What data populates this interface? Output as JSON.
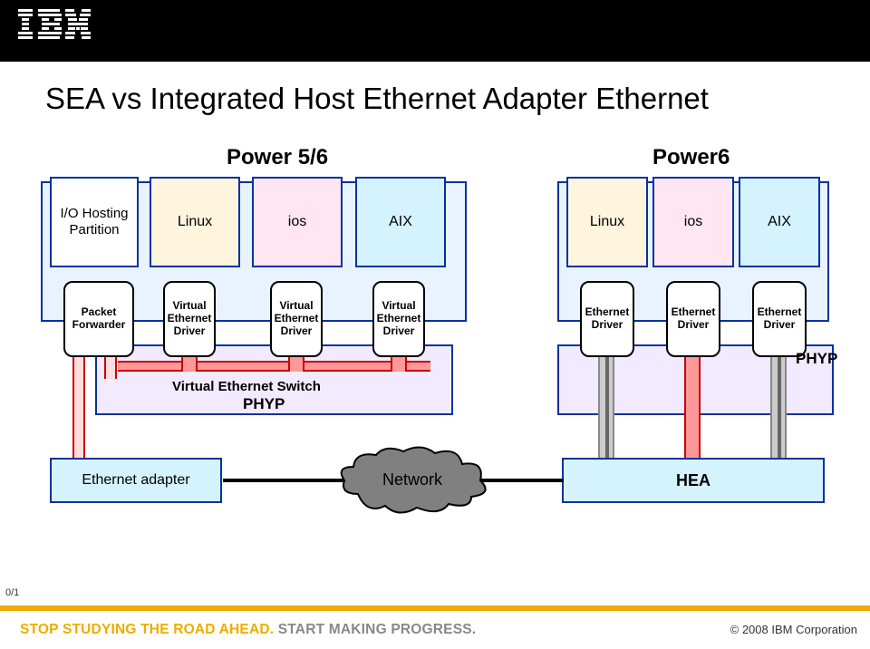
{
  "header": {
    "logo_alt": "IBM"
  },
  "title": "SEA vs Integrated Host Ethernet Adapter Ethernet",
  "labels": {
    "power56": "Power 5/6",
    "power6": "Power6"
  },
  "partitions": {
    "hosting": "I/O Hosting Partition",
    "linux": "Linux",
    "ios": "ios",
    "aix": "AIX"
  },
  "drivers": {
    "packet_forwarder": "Packet Forwarder",
    "virtual_ethernet_driver": "Virtual Ethernet Driver",
    "ethernet_driver": "Ethernet Driver"
  },
  "phyp": {
    "virtual_switch": "Virtual Ethernet Switch",
    "phyp": "PHYP"
  },
  "bottom": {
    "ethernet_adapter": "Ethernet adapter",
    "network": "Network",
    "hea": "HEA"
  },
  "footer": {
    "tagline_a": "STOP STUDYING THE ROAD AHEAD. ",
    "tagline_b": "START MAKING PROGRESS.",
    "copyright": "© 2008 IBM Corporation",
    "slide_num": "0/1"
  }
}
